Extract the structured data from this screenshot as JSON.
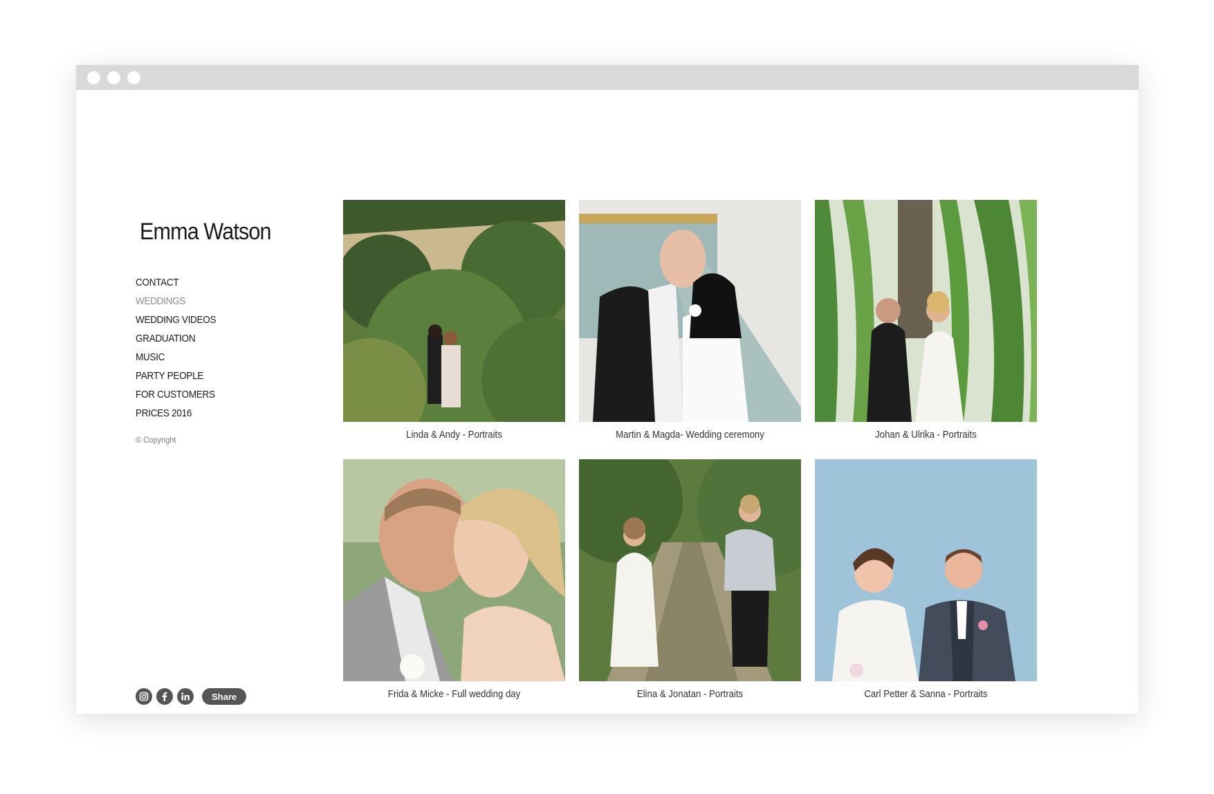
{
  "site": {
    "title": "Emma Watson"
  },
  "nav": {
    "items": [
      {
        "label": "CONTACT",
        "active": false
      },
      {
        "label": "WEDDINGS",
        "active": true
      },
      {
        "label": "WEDDING VIDEOS",
        "active": false
      },
      {
        "label": "GRADUATION",
        "active": false
      },
      {
        "label": "MUSIC",
        "active": false
      },
      {
        "label": "PARTY PEOPLE",
        "active": false
      },
      {
        "label": "FOR CUSTOMERS",
        "active": false
      },
      {
        "label": "PRICES 2016",
        "active": false
      }
    ]
  },
  "copyright": "© Copyright",
  "social": {
    "icons": [
      "instagram-icon",
      "facebook-icon",
      "linkedin-icon"
    ],
    "share_label": "Share"
  },
  "gallery": {
    "items": [
      {
        "caption": "Linda & Andy - Portraits"
      },
      {
        "caption": "Martin & Magda- Wedding ceremony"
      },
      {
        "caption": "Johan & Ulrika - Portraits"
      },
      {
        "caption": "Frida & Micke - Full wedding day"
      },
      {
        "caption": "Elina & Jonatan - Portraits"
      },
      {
        "caption": "Carl Petter & Sanna - Portraits"
      }
    ]
  },
  "colors": {
    "titlebar": "#d9d9d9",
    "nav_active": "#8c8c8c",
    "social_icon_bg": "#555555"
  }
}
